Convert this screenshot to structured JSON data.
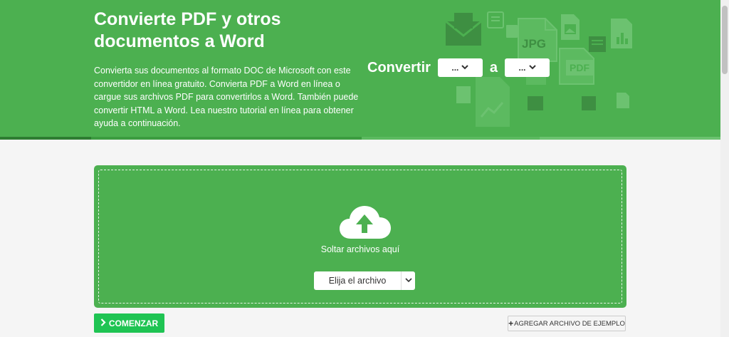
{
  "colors": {
    "hero_bg": "#4cb050",
    "accent_green": "#1fc453",
    "page_bg": "#f5f5f5"
  },
  "hero": {
    "title": "Convierte PDF y otros documentos a Word",
    "description": "Convierta sus documentos al formato DOC de Microsoft con este convertidor en línea gratuito. Convierta PDF a Word en línea o cargue sus archivos PDF para convertirlos a Word. También puede convertir HTML a Word. Lea nuestro tutorial en línea para obtener ayuda a continuación."
  },
  "converter": {
    "label": "Convertir",
    "from_value": "...",
    "separator": "a",
    "to_value": "..."
  },
  "decor_icons": {
    "jpg": "JPG",
    "pdf": "PDF"
  },
  "dropzone": {
    "drop_text": "Soltar archivos aquí",
    "choose_label": "Elija el archivo"
  },
  "actions": {
    "start_label": "COMENZAR",
    "sample_label": "AGREGAR ARCHIVO DE EJEMPLO"
  },
  "icons": {
    "upload": "cloud-upload-icon",
    "start": "chevron-right-icon",
    "sample": "plus-icon",
    "select": "chevron-down-icon"
  }
}
